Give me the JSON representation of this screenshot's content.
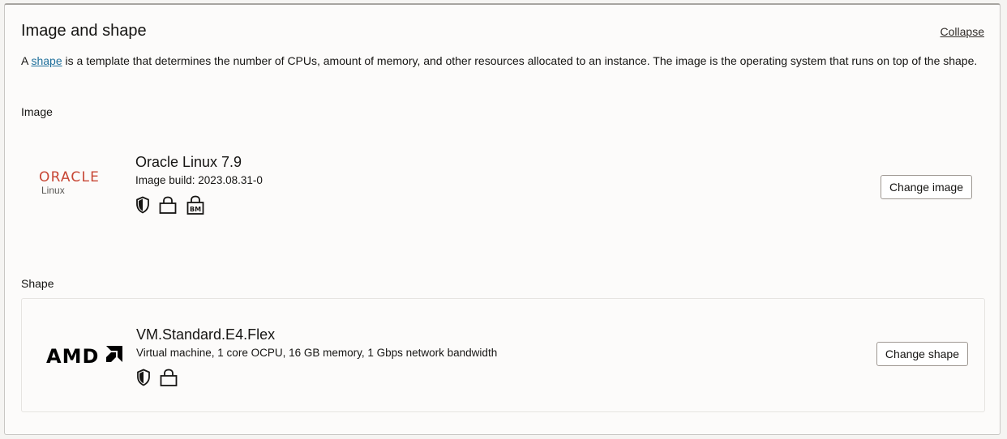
{
  "section": {
    "title": "Image and shape",
    "collapse_label": "Collapse",
    "description": {
      "prefix": "A ",
      "link_text": "shape",
      "suffix": " is a template that determines the number of CPUs, amount of memory, and other resources allocated to an instance. The image is the operating system that runs on top of the shape."
    }
  },
  "image": {
    "label": "Image",
    "logo_text": "ORACLE",
    "logo_subtext": "Linux",
    "name": "Oracle Linux 7.9",
    "build": "Image build: 2023.08.31-0",
    "icons": [
      "shield-icon",
      "lock-icon",
      "bm-lock-icon"
    ],
    "badge_text": "BM",
    "button_label": "Change image"
  },
  "shape": {
    "label": "Shape",
    "logo_text": "AMD",
    "name": "VM.Standard.E4.Flex",
    "details": "Virtual machine, 1 core OCPU, 16 GB memory, 1 Gbps network bandwidth",
    "icons": [
      "shield-icon",
      "lock-icon"
    ],
    "button_label": "Change shape"
  },
  "colors": {
    "oracle_red": "#c74634",
    "link_blue": "#1f6f9b"
  }
}
